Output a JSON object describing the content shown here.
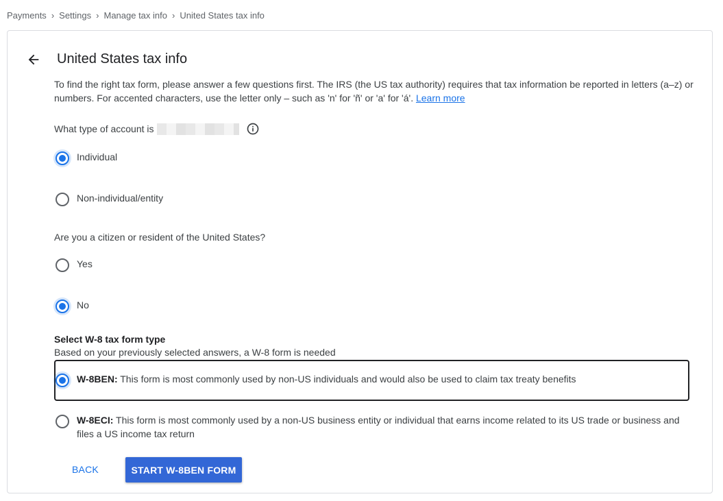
{
  "breadcrumb": [
    "Payments",
    "Settings",
    "Manage tax info",
    "United States tax info"
  ],
  "page_title": "United States tax info",
  "intro": {
    "text": "To find the right tax form, please answer a few questions first. The IRS (the US tax authority) requires that tax information be reported in letters (a–z) or numbers. For accented characters, use the letter only – such as 'n' for 'ñ' or 'a' for 'á'.",
    "link": "Learn more"
  },
  "account_question": "What type of account is",
  "account_options": [
    {
      "label": "Individual",
      "checked": true
    },
    {
      "label": "Non-individual/entity",
      "checked": false
    }
  ],
  "citizen_question": "Are you a citizen or resident of the United States?",
  "citizen_options": [
    {
      "label": "Yes",
      "checked": false
    },
    {
      "label": "No",
      "checked": true
    }
  ],
  "w8": {
    "title": "Select W-8 tax form type",
    "subtitle": "Based on your previously selected answers, a W-8 form is needed",
    "options": [
      {
        "code": "W-8BEN:",
        "description": "This form is most commonly used by non-US individuals and would also be used to claim tax treaty benefits",
        "checked": true
      },
      {
        "code": "W-8ECI:",
        "description": "This form is most commonly used by a non-US business entity or individual that earns income related to its US trade or business and files a US income tax return",
        "checked": false
      }
    ]
  },
  "buttons": {
    "back": "BACK",
    "start": "START W-8BEN FORM"
  },
  "colors": {
    "accent": "#1a73e8",
    "primary_button": "#3367d6"
  }
}
